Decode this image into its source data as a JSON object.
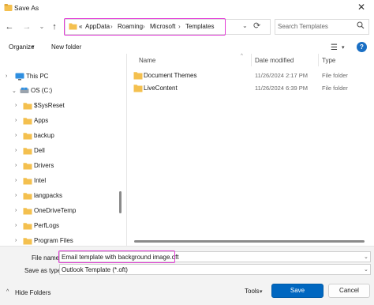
{
  "window": {
    "title": "Save As",
    "close_glyph": "✕"
  },
  "nav": {
    "back_glyph": "←",
    "forward_glyph": "→",
    "recent_glyph": "⌄",
    "up_glyph": "↑",
    "refresh_glyph": "⟳"
  },
  "address": {
    "overflow": "«",
    "crumbs": [
      "AppData",
      "Roaming",
      "Microsoft",
      "Templates"
    ],
    "separator": "›",
    "dropdown_glyph": "⌄"
  },
  "search": {
    "placeholder": "Search Templates"
  },
  "toolbar": {
    "organize_label": "Organize",
    "organize_chevron": "▾",
    "new_folder_label": "New folder",
    "view_glyph": "☰",
    "view_chevron": "▾",
    "help_glyph": "?"
  },
  "columns": {
    "name": "Name",
    "date": "Date modified",
    "type": "Type",
    "sort_caret": "^"
  },
  "files": [
    {
      "name": "Document Themes",
      "date": "11/26/2024 2:17 PM",
      "type": "File folder"
    },
    {
      "name": "LiveContent",
      "date": "11/26/2024 6:39 PM",
      "type": "File folder"
    }
  ],
  "tree": [
    {
      "label": "This PC",
      "icon": "this-pc-icon",
      "chevron": "›"
    },
    {
      "label": "OS (C:)",
      "icon": "drive-icon",
      "chevron": "⌄"
    },
    {
      "label": "$SysReset",
      "icon": "folder-icon",
      "chevron": "›"
    },
    {
      "label": "Apps",
      "icon": "folder-icon",
      "chevron": "›"
    },
    {
      "label": "backup",
      "icon": "folder-icon",
      "chevron": "›"
    },
    {
      "label": "Dell",
      "icon": "folder-icon",
      "chevron": "›"
    },
    {
      "label": "Drivers",
      "icon": "folder-icon",
      "chevron": "›"
    },
    {
      "label": "Intel",
      "icon": "folder-icon",
      "chevron": "›"
    },
    {
      "label": "langpacks",
      "icon": "folder-icon",
      "chevron": "›"
    },
    {
      "label": "OneDriveTemp",
      "icon": "folder-icon",
      "chevron": "›"
    },
    {
      "label": "PerfLogs",
      "icon": "folder-icon",
      "chevron": "›"
    },
    {
      "label": "Program Files",
      "icon": "folder-icon",
      "chevron": "›"
    }
  ],
  "form": {
    "file_name_label": "File name:",
    "file_name_value": "Email template with background image.oft",
    "save_type_label": "Save as type:",
    "save_type_value": "Outlook Template (*.oft)",
    "dropdown_glyph": "⌄"
  },
  "footer": {
    "hide_folders_label": "Hide Folders",
    "hide_chevron": "^",
    "tools_label": "Tools",
    "tools_chevron": "▾",
    "save_label": "Save",
    "cancel_label": "Cancel"
  },
  "colors": {
    "accent": "#0067c0",
    "highlight": "#e23bd6",
    "folder": "#f4c04f"
  }
}
